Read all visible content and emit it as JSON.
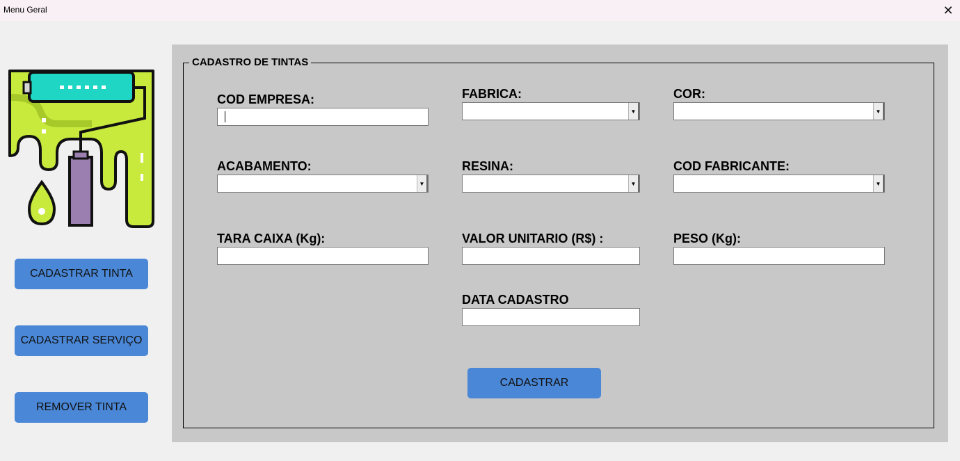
{
  "window": {
    "title": "Menu Geral",
    "close_glyph": "✕"
  },
  "sidebar": {
    "logo_icon": "paint-roller-icon",
    "buttons": [
      {
        "label": "CADASTRAR TINTA"
      },
      {
        "label": "CADASTRAR SERVIÇO"
      },
      {
        "label": "REMOVER TINTA"
      }
    ]
  },
  "form": {
    "group_title": "CADASTRO DE TINTAS",
    "fields": {
      "cod_empresa": {
        "label": "COD EMPRESA:",
        "value": ""
      },
      "fabrica": {
        "label": "FABRICA:",
        "value": ""
      },
      "cor": {
        "label": "COR:",
        "value": ""
      },
      "acabamento": {
        "label": "ACABAMENTO:",
        "value": ""
      },
      "resina": {
        "label": "RESINA:",
        "value": ""
      },
      "cod_fabricante": {
        "label": "COD FABRICANTE:",
        "value": ""
      },
      "tara_caixa": {
        "label": "TARA CAIXA (Kg):",
        "value": ""
      },
      "valor_unitario": {
        "label": "VALOR UNITARIO (R$) :",
        "value": ""
      },
      "peso": {
        "label": "PESO (Kg):",
        "value": ""
      },
      "data_cadastro": {
        "label": "DATA CADASTRO",
        "value": ""
      }
    },
    "combo_arrow_glyph": "▼",
    "submit_label": "CADASTRAR"
  },
  "colors": {
    "button_blue": "#4a87d6",
    "panel_gray": "#c8c8c8",
    "paint_lime": "#c8ea3c",
    "roller_teal": "#1fd6c4",
    "bottle_purple": "#9b7fb0"
  }
}
